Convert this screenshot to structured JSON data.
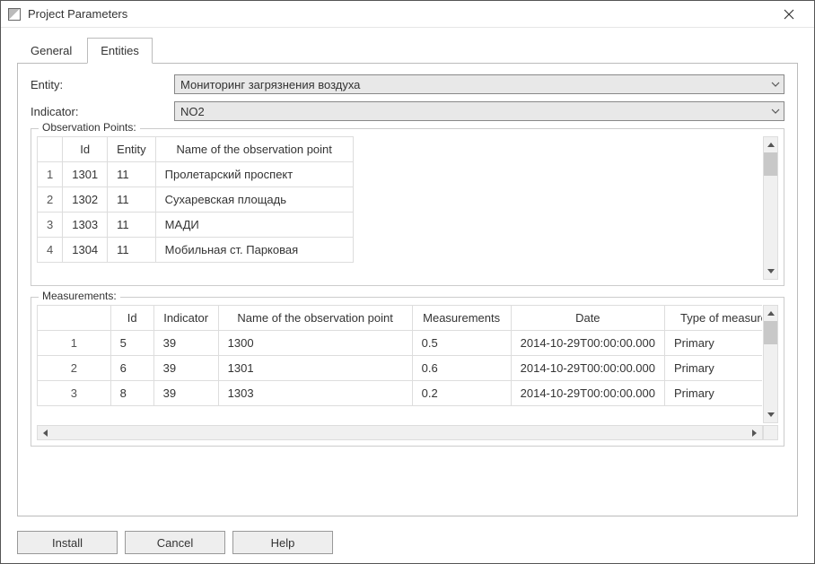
{
  "window": {
    "title": "Project Parameters"
  },
  "tabs": {
    "general": "General",
    "entities": "Entities"
  },
  "form": {
    "entity_label": "Entity:",
    "entity_value": "Мониторинг загрязнения воздуха",
    "indicator_label": "Indicator:",
    "indicator_value": "NO2"
  },
  "observation": {
    "legend": "Observation Points:",
    "headers": {
      "id": "Id",
      "entity": "Entity",
      "name": "Name of the observation point"
    },
    "rows": [
      {
        "n": "1",
        "id": "1301",
        "entity": "11",
        "name": "Пролетарский проспект"
      },
      {
        "n": "2",
        "id": "1302",
        "entity": "11",
        "name": "Сухаревская площадь"
      },
      {
        "n": "3",
        "id": "1303",
        "entity": "11",
        "name": "МАДИ"
      },
      {
        "n": "4",
        "id": "1304",
        "entity": "11",
        "name": "Мобильная ст. Парковая"
      }
    ]
  },
  "measurements": {
    "legend": "Measurements:",
    "headers": {
      "id": "Id",
      "indicator": "Indicator",
      "name": "Name of the observation point",
      "meas": "Measurements",
      "date": "Date",
      "type": "Type of measureme"
    },
    "rows": [
      {
        "n": "1",
        "id": "5",
        "indicator": "39",
        "name": "1300",
        "meas": "0.5",
        "date": "2014-10-29T00:00:00.000",
        "type": "Primary"
      },
      {
        "n": "2",
        "id": "6",
        "indicator": "39",
        "name": "1301",
        "meas": "0.6",
        "date": "2014-10-29T00:00:00.000",
        "type": "Primary"
      },
      {
        "n": "3",
        "id": "8",
        "indicator": "39",
        "name": "1303",
        "meas": "0.2",
        "date": "2014-10-29T00:00:00.000",
        "type": "Primary"
      }
    ]
  },
  "buttons": {
    "install": "Install",
    "cancel": "Cancel",
    "help": "Help"
  }
}
